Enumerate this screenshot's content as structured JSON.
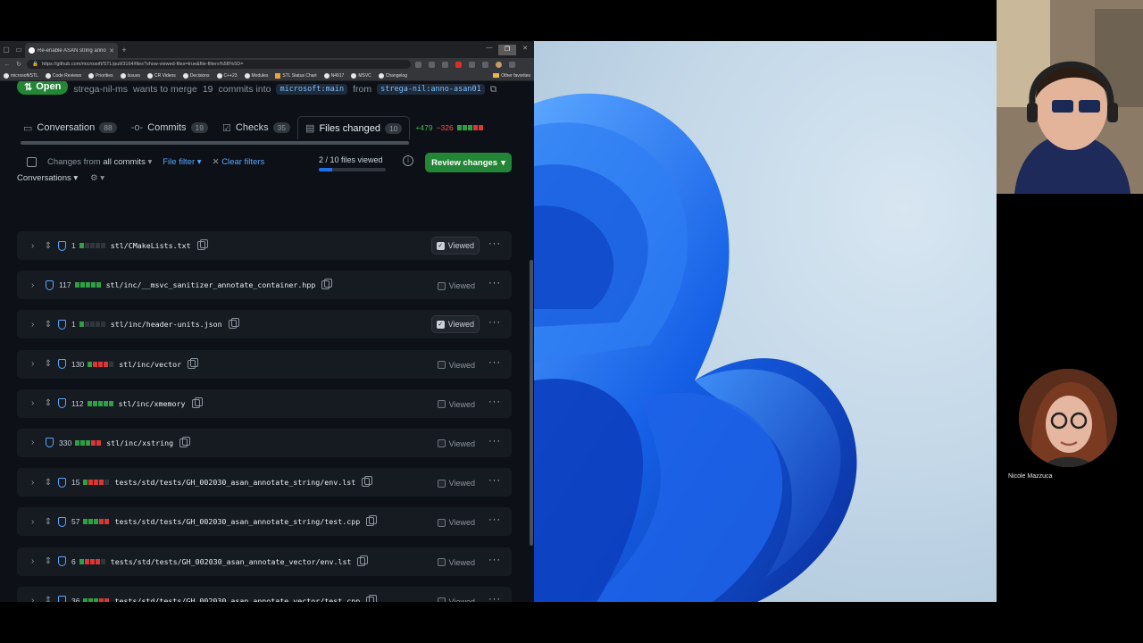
{
  "browser": {
    "tab_title": "Re-enable ASAN string annotati",
    "url": "https://github.com/microsoft/STL/pull/3164/files?show-viewed-files=true&file-filters%5B%5D=",
    "favorites": [
      "microsoft/STL",
      "Code Reviews",
      "Priorities",
      "Issues",
      "CR Videos",
      "Decisions",
      "C++23",
      "Modules",
      "STL Status Chart",
      "N4917",
      "MSVC",
      "Changelog"
    ],
    "other_favorites": "Other favorites"
  },
  "pr": {
    "state": "Open",
    "author": "strega-nil-ms",
    "merge_text_1": "wants to merge",
    "commit_count": "19",
    "merge_text_2": "commits into",
    "base_branch": "microsoft:main",
    "from_text": "from",
    "head_branch": "strega-nil:anno-asan01"
  },
  "tabs": [
    {
      "label": "Conversation",
      "count": "88",
      "icon": "comment-icon"
    },
    {
      "label": "Commits",
      "count": "19",
      "icon": "commit-icon"
    },
    {
      "label": "Checks",
      "count": "35",
      "icon": "checklist-icon"
    },
    {
      "label": "Files changed",
      "count": "10",
      "icon": "file-diff-icon"
    }
  ],
  "diffstat": {
    "additions": "+479",
    "deletions": "−326"
  },
  "toolbar": {
    "changes_from": "Changes from",
    "all_commits": "all commits",
    "file_filter": "File filter",
    "clear_filters": "Clear filters",
    "conversations": "Conversations",
    "viewed_label": "2 / 10 files viewed",
    "viewed_fraction": 0.2,
    "review_button": "Review changes"
  },
  "viewed_label": "Viewed",
  "files": [
    {
      "count": "1",
      "path": "stl/CMakeLists.txt",
      "viewed": true,
      "stat": "gnnnn",
      "expandable": true
    },
    {
      "count": "117",
      "path": "stl/inc/__msvc_sanitizer_annotate_container.hpp",
      "viewed": false,
      "stat": "ggggg",
      "expandable": false
    },
    {
      "count": "1",
      "path": "stl/inc/header-units.json",
      "viewed": true,
      "stat": "gnnnn",
      "expandable": true
    },
    {
      "count": "130",
      "path": "stl/inc/vector",
      "viewed": false,
      "stat": "grrrn",
      "expandable": true
    },
    {
      "count": "112",
      "path": "stl/inc/xmemory",
      "viewed": false,
      "stat": "ggggg",
      "expandable": true
    },
    {
      "count": "330",
      "path": "stl/inc/xstring",
      "viewed": false,
      "stat": "gggrr",
      "expandable": false
    },
    {
      "count": "15",
      "path": "tests/std/tests/GH_002030_asan_annotate_string/env.lst",
      "viewed": false,
      "stat": "grrrn",
      "expandable": true
    },
    {
      "count": "57",
      "path": "tests/std/tests/GH_002030_asan_annotate_string/test.cpp",
      "viewed": false,
      "stat": "gggrr",
      "expandable": true
    },
    {
      "count": "6",
      "path": "tests/std/tests/GH_002030_asan_annotate_vector/env.lst",
      "viewed": false,
      "stat": "grrrn",
      "expandable": true
    },
    {
      "count": "36",
      "path": "tests/std/tests/GH_002030_asan_annotate_vector/test.cpp",
      "viewed": false,
      "stat": "gggrr",
      "expandable": true
    }
  ],
  "participants": {
    "speaker2_name": "Nicole Mazzuca"
  },
  "colors": {
    "accent_green": "#238636",
    "link_blue": "#58a6ff",
    "add": "#2ea043",
    "del": "#da3633",
    "bg": "#0d1117"
  }
}
